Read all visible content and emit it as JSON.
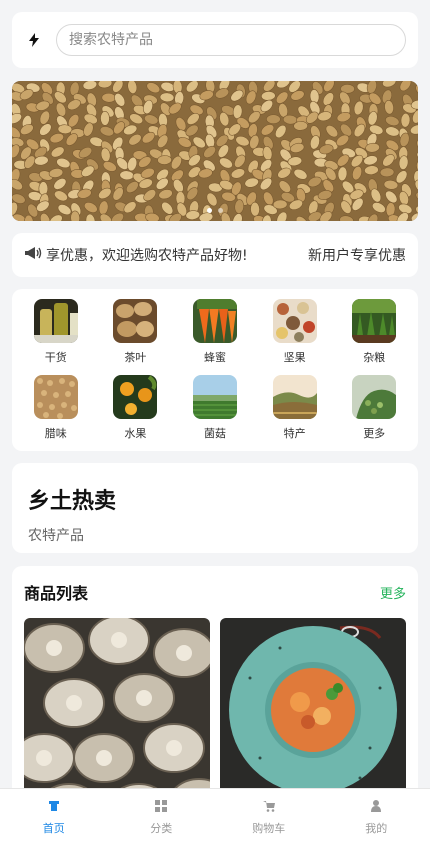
{
  "search": {
    "placeholder": "搜索农特产品",
    "logo_icon": "lightning-icon"
  },
  "banner": {
    "image": "wheat-grains",
    "dots": 2,
    "active_dot": 0
  },
  "notice": {
    "icon": "megaphone-icon",
    "text": "享优惠，欢迎选购农特产品好物!",
    "right_text": "新用户专享优惠"
  },
  "categories": [
    {
      "label": "干货",
      "image": "oil-bottles"
    },
    {
      "label": "茶叶",
      "image": "potatoes"
    },
    {
      "label": "蜂蜜",
      "image": "carrots"
    },
    {
      "label": "坚果",
      "image": "mixed-grains"
    },
    {
      "label": "杂粮",
      "image": "crops-field"
    },
    {
      "label": "腊味",
      "image": "wheat"
    },
    {
      "label": "水果",
      "image": "oranges"
    },
    {
      "label": "菌菇",
      "image": "farm-field"
    },
    {
      "label": "特产",
      "image": "hills-field"
    },
    {
      "label": "更多",
      "image": "tomato-plant"
    }
  ],
  "hot": {
    "title": "乡土热卖",
    "subtitle": "农特产品"
  },
  "product_list": {
    "title": "商品列表",
    "more": "更多",
    "items": [
      {
        "image": "shiitake-mushrooms"
      },
      {
        "image": "soup-bowl"
      }
    ]
  },
  "tabbar": {
    "items": [
      {
        "label": "首页",
        "icon": "home-icon",
        "active": true
      },
      {
        "label": "分类",
        "icon": "grid-icon",
        "active": false
      },
      {
        "label": "购物车",
        "icon": "cart-icon",
        "active": false
      },
      {
        "label": "我的",
        "icon": "user-icon",
        "active": false
      }
    ]
  },
  "colors": {
    "accent": "#1e88e5",
    "more_link": "#24b35b",
    "background": "#f3f4f6"
  }
}
